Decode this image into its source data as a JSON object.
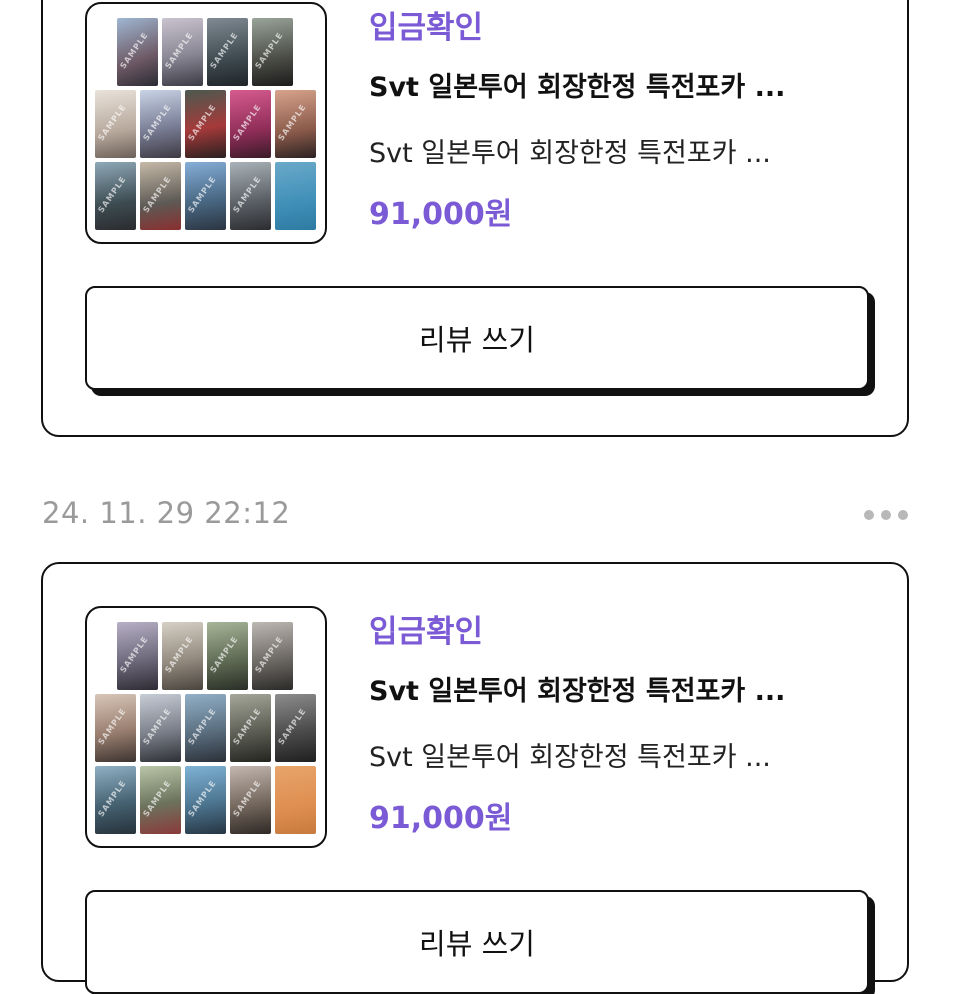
{
  "orders": [
    {
      "status": "입금확인",
      "title": "Svt 일본투어 회장한정 특전포카 ...",
      "subtitle": "Svt 일본투어 회장한정 특전포카 ...",
      "price": "91,000원",
      "review_label": "리뷰 쓰기",
      "thumbnail": "photocard-collage"
    },
    {
      "status": "입금확인",
      "title": "Svt 일본투어 회장한정 특전포카 ...",
      "subtitle": "Svt 일본투어 회장한정 특전포카 ...",
      "price": "91,000원",
      "review_label": "리뷰 쓰기",
      "thumbnail": "photocard-collage"
    }
  ],
  "second_order_date": "24. 11. 29 22:12",
  "more_icon": "more-horizontal-icon",
  "colors": {
    "accent": "#7b5ad6",
    "date_gray": "#9a9a9a",
    "border": "#111111"
  }
}
